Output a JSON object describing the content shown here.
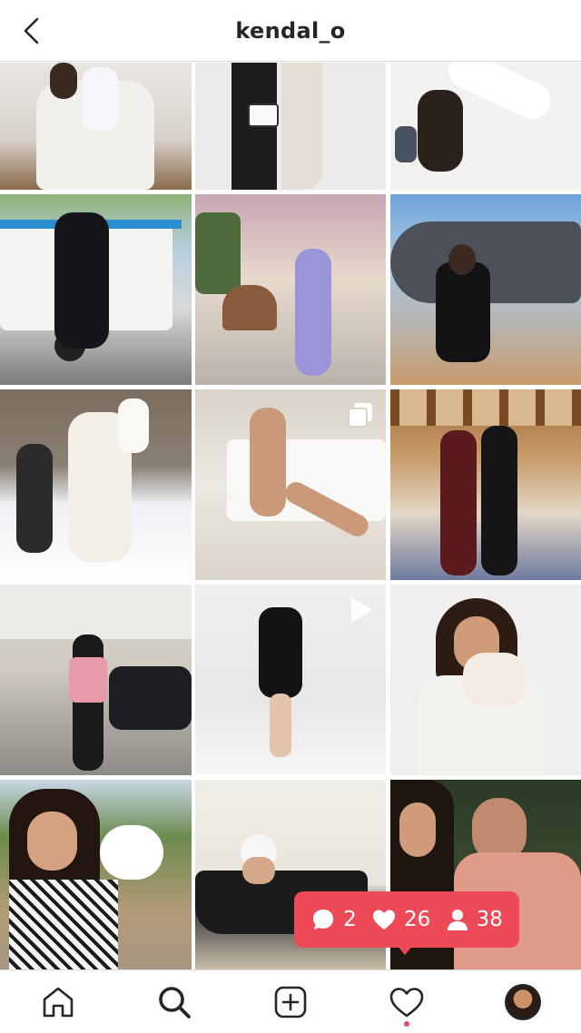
{
  "header": {
    "title": "kendal_o",
    "back_icon": "chevron-left-icon"
  },
  "posts": [
    {
      "label": "mother-holding-baby-in-armchair",
      "type": "photo"
    },
    {
      "label": "couple-legs-with-handbag",
      "type": "photo"
    },
    {
      "label": "yoga-handstand-with-child",
      "type": "photo"
    },
    {
      "label": "woman-with-baby-in-golf-cart",
      "type": "photo"
    },
    {
      "label": "woman-with-stroller",
      "type": "photo"
    },
    {
      "label": "woman-on-private-jet-stairs",
      "type": "photo"
    },
    {
      "label": "family-in-snow",
      "type": "photo"
    },
    {
      "label": "woman-on-sofa",
      "type": "carousel"
    },
    {
      "label": "two-women-in-chalet",
      "type": "photo"
    },
    {
      "label": "woman-in-pink-jacket-street",
      "type": "photo"
    },
    {
      "label": "woman-in-black-dress-hallway",
      "type": "video"
    },
    {
      "label": "mother-cradling-newborn",
      "type": "photo"
    },
    {
      "label": "woman-holding-baby-in-bonnet",
      "type": "photo"
    },
    {
      "label": "woman-in-bathtub",
      "type": "photo"
    },
    {
      "label": "selfie-with-man-in-pink-shirt",
      "type": "photo"
    }
  ],
  "notification": {
    "comments": "2",
    "likes": "26",
    "followers": "38",
    "comment_icon": "comment-bubble-icon",
    "like_icon": "heart-icon",
    "follower_icon": "person-icon"
  },
  "tab_bar": {
    "items": [
      "home-icon",
      "search-icon",
      "new-post-icon",
      "activity-heart-icon",
      "profile-avatar-icon"
    ],
    "active": "search",
    "activity_dot": true
  },
  "colors": {
    "accent": "#ed4956",
    "text": "#262626",
    "divider": "#dbdbdb"
  }
}
